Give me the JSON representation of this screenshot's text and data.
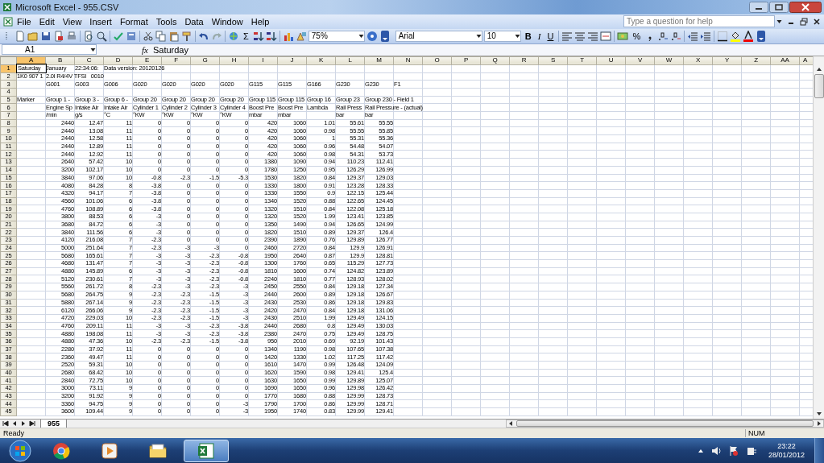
{
  "window": {
    "title": "Microsoft Excel - 955.CSV"
  },
  "menu": [
    "File",
    "Edit",
    "View",
    "Insert",
    "Format",
    "Tools",
    "Data",
    "Window",
    "Help"
  ],
  "help_field": {
    "placeholder": "Type a question for help"
  },
  "toolbar": {
    "sum": "Σ",
    "zoom": "75%",
    "font": "Arial",
    "font_size": "10",
    "format_buttons": [
      "B",
      "I",
      "U"
    ],
    "percent": "%"
  },
  "formula_bar": {
    "name_box": "A1",
    "fx": "fx",
    "value": "Saturday"
  },
  "sheet": {
    "columns": [
      {
        "label": "A",
        "selected": true
      },
      {
        "label": "B",
        "selected": false
      },
      {
        "label": "C",
        "selected": false
      },
      {
        "label": "D",
        "selected": false
      },
      {
        "label": "E",
        "selected": false
      },
      {
        "label": "F",
        "selected": false
      },
      {
        "label": "G",
        "selected": false
      },
      {
        "label": "H",
        "selected": false
      },
      {
        "label": "I",
        "selected": false
      },
      {
        "label": "J",
        "selected": false
      },
      {
        "label": "K",
        "selected": false
      },
      {
        "label": "L",
        "selected": false
      },
      {
        "label": "M",
        "selected": false
      },
      {
        "label": "N",
        "selected": false
      },
      {
        "label": "O",
        "selected": false
      },
      {
        "label": "P",
        "selected": false
      },
      {
        "label": "Q",
        "selected": false
      },
      {
        "label": "R",
        "selected": false
      },
      {
        "label": "S",
        "selected": false
      },
      {
        "label": "T",
        "selected": false
      },
      {
        "label": "U",
        "selected": false
      },
      {
        "label": "V",
        "selected": false
      },
      {
        "label": "W",
        "selected": false
      },
      {
        "label": "X",
        "selected": false
      },
      {
        "label": "Y",
        "selected": false
      },
      {
        "label": "Z",
        "selected": false
      },
      {
        "label": "AA",
        "selected": false
      },
      {
        "label": "A",
        "selected": false
      }
    ],
    "rows": [
      {
        "number": "1",
        "selected": true,
        "kind": "text",
        "cells": [
          "Saturday",
          "January",
          "22:34:06:",
          "Data version: 20120126"
        ]
      },
      {
        "number": "2",
        "selected": false,
        "kind": "text",
        "cells": [
          "1K0 907 1",
          "2.0l R4/4V TFSI   0010"
        ]
      },
      {
        "number": "3",
        "selected": false,
        "kind": "text",
        "cells": [
          null,
          "G001",
          "G003",
          "G006",
          "G020",
          "G020",
          "G020",
          "G020",
          "G115",
          "G115",
          "G166",
          "G230",
          "G230",
          "F1"
        ]
      },
      {
        "number": "4",
        "selected": false,
        "kind": "text"
      },
      {
        "number": "5",
        "selected": false,
        "kind": "text",
        "cells": [
          "Marker",
          "Group 1 -",
          "Group 3 -",
          "Group 6 -",
          "Group 20",
          "Group 20",
          "Group 20",
          "Group 20",
          "Group 115",
          "Group 115",
          "Group 16",
          "Group 23",
          "Group 230 - Field 1"
        ]
      },
      {
        "number": "6",
        "selected": false,
        "kind": "text",
        "cells": [
          null,
          "Engine Sp",
          "Intake Air",
          "Intake Air",
          "Cylinder 1",
          "Cylinder 2",
          "Cylinder 3",
          "Cylinder 4",
          "Boost Pre",
          "Boost Pre",
          "Lambda",
          "Rail Press",
          "Rail Pressure - (actual)"
        ]
      },
      {
        "number": "7",
        "selected": false,
        "kind": "text",
        "cells": [
          null,
          "/min",
          "g/s",
          "°C",
          "°KW",
          "°KW",
          "°KW",
          "°KW",
          "mbar",
          "mbar",
          null,
          "bar",
          "bar"
        ]
      },
      {
        "number": "8",
        "selected": false,
        "kind": "number",
        "cells": [
          null,
          "2440",
          "12.47",
          "11",
          "0",
          "0",
          "0",
          "0",
          "420",
          "1060",
          "1.01",
          "55.61",
          "55.55"
        ]
      },
      {
        "number": "9",
        "selected": false,
        "kind": "number",
        "cells": [
          null,
          "2440",
          "13.08",
          "11",
          "0",
          "0",
          "0",
          "0",
          "420",
          "1060",
          "0.98",
          "55.55",
          "55.85"
        ]
      },
      {
        "number": "10",
        "selected": false,
        "kind": "number",
        "cells": [
          null,
          "2440",
          "12.58",
          "11",
          "0",
          "0",
          "0",
          "0",
          "420",
          "1060",
          "1",
          "55.31",
          "55.36"
        ]
      },
      {
        "number": "11",
        "selected": false,
        "kind": "number",
        "cells": [
          null,
          "2440",
          "12.89",
          "11",
          "0",
          "0",
          "0",
          "0",
          "420",
          "1060",
          "0.96",
          "54.48",
          "54.07"
        ]
      },
      {
        "number": "12",
        "selected": false,
        "kind": "number",
        "cells": [
          null,
          "2440",
          "12.92",
          "11",
          "0",
          "0",
          "0",
          "0",
          "420",
          "1060",
          "0.98",
          "54.31",
          "53.73"
        ]
      },
      {
        "number": "13",
        "selected": false,
        "kind": "number",
        "cells": [
          null,
          "2640",
          "57.42",
          "10",
          "0",
          "0",
          "0",
          "0",
          "1380",
          "1090",
          "0.94",
          "110.23",
          "112.41"
        ]
      },
      {
        "number": "14",
        "selected": false,
        "kind": "number",
        "cells": [
          null,
          "3200",
          "102.17",
          "10",
          "0",
          "0",
          "0",
          "0",
          "1780",
          "1250",
          "0.95",
          "126.29",
          "126.99"
        ]
      },
      {
        "number": "15",
        "selected": false,
        "kind": "number",
        "cells": [
          null,
          "3840",
          "97.06",
          "10",
          "-0.8",
          "-2.3",
          "-1.5",
          "-5.3",
          "1530",
          "1820",
          "0.84",
          "129.37",
          "129.03"
        ]
      },
      {
        "number": "16",
        "selected": false,
        "kind": "number",
        "cells": [
          null,
          "4080",
          "84.28",
          "8",
          "-3.8",
          "0",
          "0",
          "0",
          "1330",
          "1800",
          "0.91",
          "123.28",
          "128.33"
        ]
      },
      {
        "number": "17",
        "selected": false,
        "kind": "number",
        "cells": [
          null,
          "4320",
          "94.17",
          "7",
          "-3.8",
          "0",
          "0",
          "0",
          "1330",
          "1550",
          "0.9",
          "122.15",
          "125.44"
        ]
      },
      {
        "number": "18",
        "selected": false,
        "kind": "number",
        "cells": [
          null,
          "4560",
          "101.06",
          "6",
          "-3.8",
          "0",
          "0",
          "0",
          "1340",
          "1520",
          "0.88",
          "122.65",
          "124.45"
        ]
      },
      {
        "number": "19",
        "selected": false,
        "kind": "number",
        "cells": [
          null,
          "4760",
          "108.89",
          "6",
          "-3.8",
          "0",
          "0",
          "0",
          "1320",
          "1510",
          "0.84",
          "122.08",
          "125.18"
        ]
      },
      {
        "number": "20",
        "selected": false,
        "kind": "number",
        "cells": [
          null,
          "3800",
          "88.53",
          "6",
          "-3",
          "0",
          "0",
          "0",
          "1320",
          "1520",
          "1.99",
          "123.41",
          "123.85"
        ]
      },
      {
        "number": "21",
        "selected": false,
        "kind": "number",
        "cells": [
          null,
          "3680",
          "84.72",
          "6",
          "-3",
          "0",
          "0",
          "0",
          "1350",
          "1490",
          "0.94",
          "126.65",
          "124.99"
        ]
      },
      {
        "number": "22",
        "selected": false,
        "kind": "number",
        "cells": [
          null,
          "3840",
          "111.56",
          "6",
          "-3",
          "0",
          "0",
          "0",
          "1820",
          "1510",
          "0.89",
          "129.37",
          "126.4"
        ]
      },
      {
        "number": "23",
        "selected": false,
        "kind": "number",
        "cells": [
          null,
          "4120",
          "216.08",
          "7",
          "-2.3",
          "0",
          "0",
          "0",
          "2390",
          "1890",
          "0.76",
          "129.89",
          "126.77"
        ]
      },
      {
        "number": "24",
        "selected": false,
        "kind": "number",
        "cells": [
          null,
          "5000",
          "251.64",
          "7",
          "-2.3",
          "-3",
          "-3",
          "0",
          "2460",
          "2720",
          "0.84",
          "129.9",
          "126.91"
        ]
      },
      {
        "number": "25",
        "selected": false,
        "kind": "number",
        "cells": [
          null,
          "5680",
          "165.61",
          "7",
          "-3",
          "-3",
          "-2.3",
          "-0.8",
          "1950",
          "2640",
          "0.87",
          "129.9",
          "128.81"
        ]
      },
      {
        "number": "26",
        "selected": false,
        "kind": "number",
        "cells": [
          null,
          "4680",
          "131.47",
          "7",
          "-3",
          "-3",
          "-2.3",
          "-0.8",
          "1300",
          "1760",
          "0.65",
          "115.29",
          "127.73"
        ]
      },
      {
        "number": "27",
        "selected": false,
        "kind": "number",
        "cells": [
          null,
          "4880",
          "145.89",
          "6",
          "-3",
          "-3",
          "-2.3",
          "-0.8",
          "1810",
          "1600",
          "0.74",
          "124.82",
          "123.89"
        ]
      },
      {
        "number": "28",
        "selected": false,
        "kind": "number",
        "cells": [
          null,
          "5120",
          "230.61",
          "7",
          "-3",
          "-3",
          "-2.3",
          "-0.8",
          "2240",
          "1810",
          "0.77",
          "128.93",
          "128.02"
        ]
      },
      {
        "number": "29",
        "selected": false,
        "kind": "number",
        "cells": [
          null,
          "5560",
          "261.72",
          "8",
          "-2.3",
          "-3",
          "-2.3",
          "-3",
          "2450",
          "2550",
          "0.84",
          "129.18",
          "127.34"
        ]
      },
      {
        "number": "30",
        "selected": false,
        "kind": "number",
        "cells": [
          null,
          "5680",
          "264.75",
          "9",
          "-2.3",
          "-2.3",
          "-1.5",
          "-3",
          "2440",
          "2600",
          "0.89",
          "129.18",
          "126.67"
        ]
      },
      {
        "number": "31",
        "selected": false,
        "kind": "number",
        "cells": [
          null,
          "5880",
          "267.14",
          "9",
          "-2.3",
          "-2.3",
          "-1.5",
          "-3",
          "2430",
          "2530",
          "0.86",
          "129.18",
          "129.83"
        ]
      },
      {
        "number": "32",
        "selected": false,
        "kind": "number",
        "cells": [
          null,
          "6120",
          "266.06",
          "9",
          "-2.3",
          "-2.3",
          "-1.5",
          "-3",
          "2420",
          "2470",
          "0.84",
          "129.18",
          "131.06"
        ]
      },
      {
        "number": "33",
        "selected": false,
        "kind": "number",
        "cells": [
          null,
          "4720",
          "229.03",
          "10",
          "-2.3",
          "-2.3",
          "-1.5",
          "-3",
          "2430",
          "2510",
          "1.99",
          "129.49",
          "124.15"
        ]
      },
      {
        "number": "34",
        "selected": false,
        "kind": "number",
        "cells": [
          null,
          "4760",
          "209.11",
          "11",
          "-3",
          "-3",
          "-2.3",
          "-3.8",
          "2440",
          "2680",
          "0.8",
          "129.49",
          "130.03"
        ]
      },
      {
        "number": "35",
        "selected": false,
        "kind": "number",
        "cells": [
          null,
          "4880",
          "198.08",
          "11",
          "-3",
          "-3",
          "-2.3",
          "-3.8",
          "2380",
          "2470",
          "0.75",
          "129.49",
          "128.75"
        ]
      },
      {
        "number": "36",
        "selected": false,
        "kind": "number",
        "cells": [
          null,
          "4880",
          "47.36",
          "10",
          "-2.3",
          "-2.3",
          "-1.5",
          "-3.8",
          "950",
          "2010",
          "0.69",
          "92.19",
          "101.43"
        ]
      },
      {
        "number": "37",
        "selected": false,
        "kind": "number",
        "cells": [
          null,
          "2280",
          "37.92",
          "11",
          "0",
          "0",
          "0",
          "0",
          "1340",
          "1190",
          "0.98",
          "107.65",
          "107.38"
        ]
      },
      {
        "number": "38",
        "selected": false,
        "kind": "number",
        "cells": [
          null,
          "2360",
          "49.47",
          "11",
          "0",
          "0",
          "0",
          "0",
          "1420",
          "1330",
          "1.02",
          "117.25",
          "117.42"
        ]
      },
      {
        "number": "39",
        "selected": false,
        "kind": "number",
        "cells": [
          null,
          "2520",
          "59.31",
          "10",
          "0",
          "0",
          "0",
          "0",
          "1610",
          "1470",
          "0.99",
          "126.48",
          "124.09"
        ]
      },
      {
        "number": "40",
        "selected": false,
        "kind": "number",
        "cells": [
          null,
          "2680",
          "68.42",
          "10",
          "0",
          "0",
          "0",
          "0",
          "1620",
          "1590",
          "0.98",
          "129.41",
          "125.4"
        ]
      },
      {
        "number": "41",
        "selected": false,
        "kind": "number",
        "cells": [
          null,
          "2840",
          "72.75",
          "10",
          "0",
          "0",
          "0",
          "0",
          "1630",
          "1650",
          "0.99",
          "129.89",
          "125.07"
        ]
      },
      {
        "number": "42",
        "selected": false,
        "kind": "number",
        "cells": [
          null,
          "3000",
          "73.11",
          "9",
          "0",
          "0",
          "0",
          "0",
          "1690",
          "1650",
          "0.96",
          "129.98",
          "126.42"
        ]
      },
      {
        "number": "43",
        "selected": false,
        "kind": "number",
        "cells": [
          null,
          "3200",
          "91.92",
          "9",
          "0",
          "0",
          "0",
          "0",
          "1770",
          "1680",
          "0.88",
          "129.99",
          "128.73"
        ]
      },
      {
        "number": "44",
        "selected": false,
        "kind": "number",
        "cells": [
          null,
          "3360",
          "94.75",
          "9",
          "0",
          "0",
          "0",
          "-3",
          "1790",
          "1700",
          "0.86",
          "129.99",
          "128.71"
        ]
      },
      {
        "number": "45",
        "selected": false,
        "kind": "number",
        "cells": [
          null,
          "3600",
          "109.44",
          "9",
          "0",
          "0",
          "0",
          "-3",
          "1950",
          "1740",
          "0.83",
          "129.99",
          "129.41"
        ]
      }
    ]
  },
  "sheet_tabs": [
    {
      "label": "955",
      "selected": true
    }
  ],
  "status_bar": {
    "text": "Ready",
    "indicator": "NUM"
  },
  "taskbar": {
    "apps": [
      {
        "selected": false
      },
      {
        "selected": false
      },
      {
        "selected": false
      },
      {
        "selected": true
      }
    ],
    "time": "23:22",
    "date": "28/01/2012"
  }
}
